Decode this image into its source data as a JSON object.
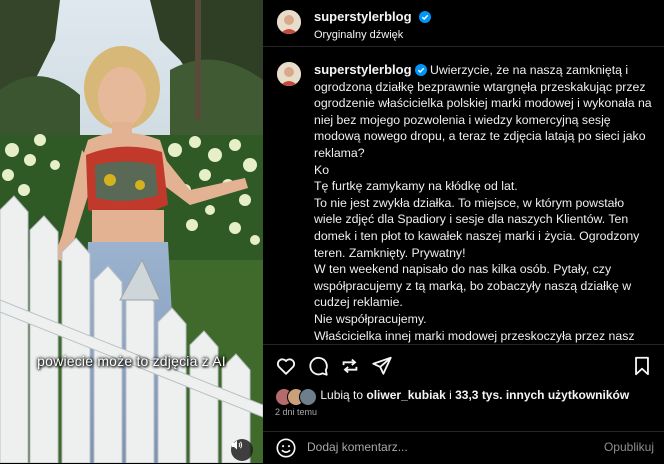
{
  "media": {
    "caption": "powiecie może to zdjęcia z AI",
    "mute_icon": "speaker-icon"
  },
  "header": {
    "username": "superstylerblog",
    "audio_label": "Oryginalny dźwięk"
  },
  "post": {
    "username": "superstylerblog",
    "paragraphs": [
      "Uwierzycie, że na naszą zamkniętą i ogrodzoną działkę bezprawnie wtargnęła przeskakując przez ogrodzenie właścicielka polskiej marki modowej i wykonała na niej bez mojego pozwolenia i wiedzy komercyjną sesję modową nowego dropu, a teraz te zdjęcia latają po sieci jako reklama?",
      "Ko",
      "Tę furtkę zamykamy na kłódkę od lat.",
      "To nie jest zwykła działka. To miejsce, w którym powstało wiele zdjęć dla Spadiory i sesje dla naszych Klientów. Ten domek i ten płot to kawałek naszej marki i życia. Ogrodzony teren. Zamknięty. Prywatny!",
      "W ten weekend napisało do nas kilka osób. Pytały, czy współpracujemy z tą marką, bo zobaczyły naszą działkę w cudzej reklamie.",
      "Nie współpracujemy.",
      "Właścicielka innej marki modowej przeskoczyła przez nasz płot. Weszła na teren, na który nie miała prawa wejść. Nikt jej nie wpuścił, nikt jej nie zaprosił, nikt o niczym nie wiedział, nie pytała o zgodę. Nie tylko weszła na nasz teren, ale również położyła się"
    ]
  },
  "likes": {
    "prefix": "Lubią to",
    "user": "oliwer_kubiak",
    "connector": "i",
    "others": "33,3 tys. innych użytkowników"
  },
  "date": "2 dni temu",
  "comment": {
    "placeholder": "Dodaj komentarz...",
    "publish_label": "Opublikuj"
  },
  "colors": {
    "background": "#000000",
    "verified": "#0095f6",
    "border": "#262626",
    "muted_text": "#a8a8a8"
  }
}
